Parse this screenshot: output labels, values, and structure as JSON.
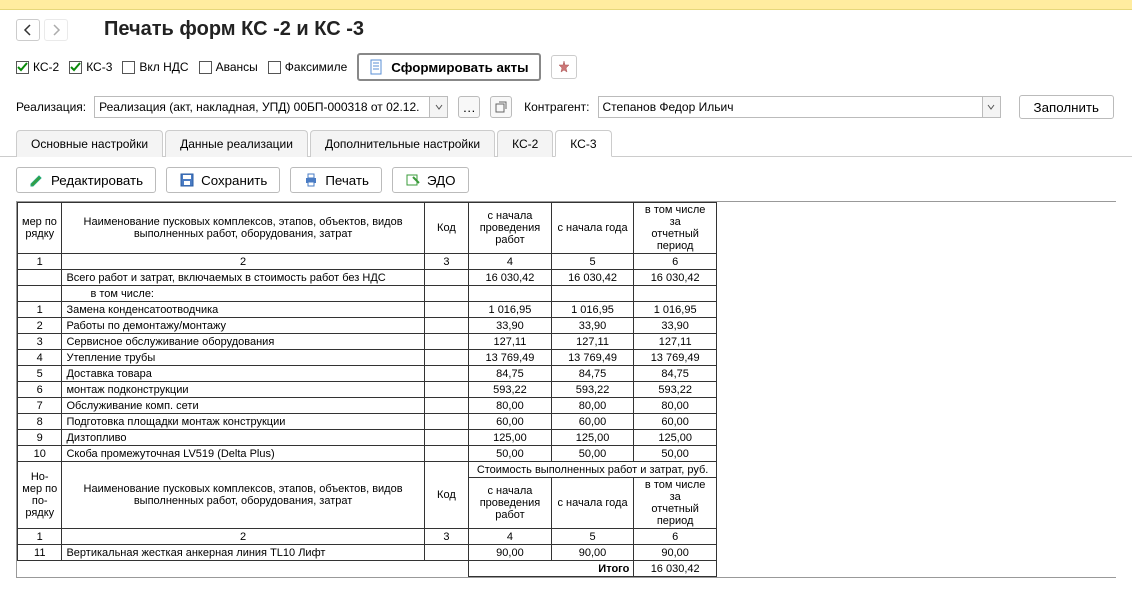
{
  "title": "Печать форм КС -2 и КС -3",
  "toolbar": {
    "ks2": "КС-2",
    "ks3": "КС-3",
    "vkl_nds": "Вкл НДС",
    "avansy": "Авансы",
    "faksimile": "Факсимиле",
    "form_acts": "Сформировать акты"
  },
  "fields": {
    "realiz_label": "Реализация:",
    "realiz_value": "Реализация (акт, накладная, УПД) 00БП-000318 от 02.12.",
    "agent_label": "Контрагент:",
    "agent_value": "Степанов Федор Ильич",
    "fill": "Заполнить"
  },
  "tabs": [
    "Основные настройки",
    "Данные реализации",
    "Дополнительные настройки",
    "КС-2",
    "КС-3"
  ],
  "actions": {
    "edit": "Редактировать",
    "save": "Сохранить",
    "print": "Печать",
    "edo": "ЭДО"
  },
  "headers": {
    "num_top": "мер по по-",
    "num_bot": "рядку",
    "name_truncated": "Наименование пусковых комплексов, этапов, объектов, видов",
    "name_line2": "выполненных работ, оборудования, затрат",
    "name_full_l1": "Наименование пусковых комплексов, этапов, объектов, видов",
    "name_full_l2": "выполненных работ, оборудования, затрат",
    "num2_l1": "Но-",
    "num2_l2": "мер по",
    "num2_l3": "по-",
    "num2_l4": "рядку",
    "code": "Код",
    "col4_l1": "с начала",
    "col4_l2": "проведения",
    "col4_l3": "работ",
    "col5": "с начала  года",
    "col6_l1": "в том числе за",
    "col6_l2": "отчетный",
    "col6_l3": "период",
    "cost_span": "Стоимость выполненных работ и затрат, руб.",
    "c1": "1",
    "c2": "2",
    "c3": "3",
    "c4": "4",
    "c5": "5",
    "c6": "6",
    "total_label": "Всего работ и затрат, включаемых в стоимость работ без НДС",
    "vtom": "в том числе:",
    "itogo": "Итого"
  },
  "totals": {
    "v1": "16 030,42",
    "v2": "16 030,42",
    "v3": "16 030,42",
    "itogo": "16 030,42"
  },
  "rows": [
    {
      "n": "1",
      "name": "Замена конденсатоотводчика",
      "a": "1 016,95",
      "b": "1 016,95",
      "c": "1 016,95"
    },
    {
      "n": "2",
      "name": "Работы по демонтажу/монтажу",
      "a": "33,90",
      "b": "33,90",
      "c": "33,90"
    },
    {
      "n": "3",
      "name": "Сервисное обслуживание оборудования",
      "a": "127,11",
      "b": "127,11",
      "c": "127,11"
    },
    {
      "n": "4",
      "name": "Утепление трубы",
      "a": "13 769,49",
      "b": "13 769,49",
      "c": "13 769,49"
    },
    {
      "n": "5",
      "name": "Доставка товара",
      "a": "84,75",
      "b": "84,75",
      "c": "84,75"
    },
    {
      "n": "6",
      "name": "монтаж подконструкции",
      "a": "593,22",
      "b": "593,22",
      "c": "593,22"
    },
    {
      "n": "7",
      "name": "Обслуживание комп. сети",
      "a": "80,00",
      "b": "80,00",
      "c": "80,00"
    },
    {
      "n": "8",
      "name": "Подготовка площадки монтаж конструкции",
      "a": "60,00",
      "b": "60,00",
      "c": "60,00"
    },
    {
      "n": "9",
      "name": "Дизтопливо",
      "a": "125,00",
      "b": "125,00",
      "c": "125,00"
    },
    {
      "n": "10",
      "name": "Скоба промежуточная LV519 (Delta Plus)",
      "a": "50,00",
      "b": "50,00",
      "c": "50,00"
    }
  ],
  "row11": {
    "n": "11",
    "name": "Вертикальная жесткая анкерная линия TL10 Лифт",
    "a": "90,00",
    "b": "90,00",
    "c": "90,00"
  }
}
